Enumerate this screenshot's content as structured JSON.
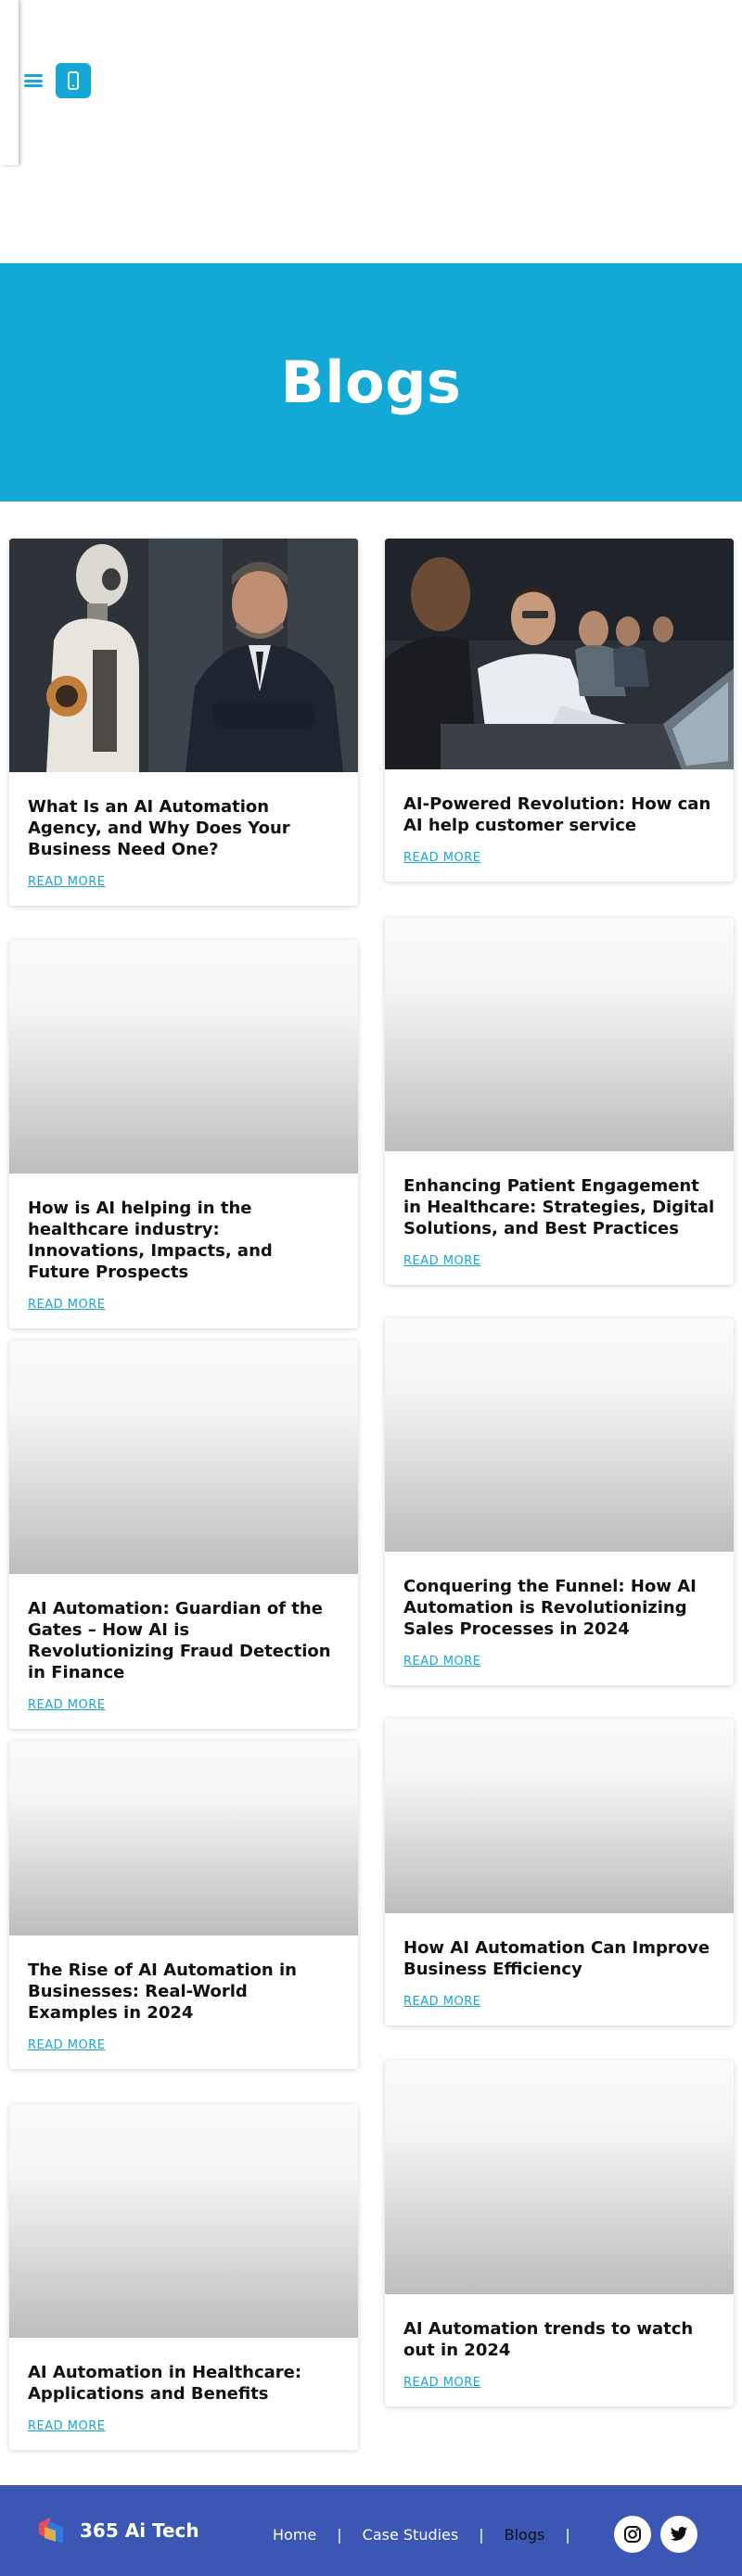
{
  "header": {
    "menu_icon": "hamburger-menu-icon",
    "phone_icon": "mobile-phone-icon",
    "accent_color": "#17a6d8"
  },
  "hero": {
    "title": "Blogs",
    "background": "#14a8d6"
  },
  "posts": [
    {
      "title": "What Is an AI Automation Agency, and Why Does Your Business Need One?",
      "read_more": "READ MORE",
      "image": "robot-and-businessman"
    },
    {
      "title": "AI-Powered Revolution: How can AI help customer service",
      "read_more": "READ MORE",
      "image": "call-center-agents"
    },
    {
      "title": "How is AI helping in the healthcare industry: Innovations, Impacts, and Future Prospects",
      "read_more": "READ MORE",
      "image": "placeholder"
    },
    {
      "title": "Enhancing Patient Engagement in Healthcare: Strategies, Digital Solutions, and Best Practices",
      "read_more": "READ MORE",
      "image": "placeholder"
    },
    {
      "title": "AI Automation: Guardian of the Gates – How AI is Revolutionizing Fraud Detection in Finance",
      "read_more": "READ MORE",
      "image": "placeholder"
    },
    {
      "title": "Conquering the Funnel: How AI Automation is Revolutionizing Sales Processes in 2024",
      "read_more": "READ MORE",
      "image": "placeholder"
    },
    {
      "title": "The Rise of AI Automation in Businesses: Real-World Examples in 2024",
      "read_more": "READ MORE",
      "image": "placeholder"
    },
    {
      "title": "How AI Automation Can Improve Business Efficiency",
      "read_more": "READ MORE",
      "image": "placeholder"
    },
    {
      "title": "AI Automation in Healthcare: Applications and Benefits",
      "read_more": "READ MORE",
      "image": "placeholder"
    },
    {
      "title": "AI Automation trends to watch out in 2024",
      "read_more": "READ MORE",
      "image": "placeholder"
    }
  ],
  "footer": {
    "brand": "365 Ai Tech",
    "nav": [
      {
        "label": "Home"
      },
      {
        "label": "Case Studies"
      },
      {
        "label": "Blogs"
      }
    ],
    "social_icons": [
      "instagram-icon",
      "twitter-icon"
    ],
    "background": "#3c56b3"
  }
}
